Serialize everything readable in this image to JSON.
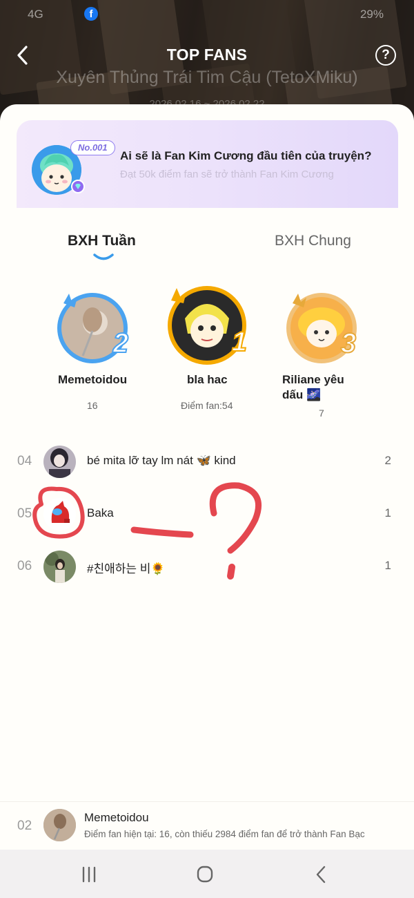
{
  "status_bar": {
    "left_text": "4G",
    "fb_glyph": "f",
    "right_text": "29%"
  },
  "header": {
    "title": "TOP FANS",
    "back_icon": "chevron-left-icon",
    "help_label": "?",
    "story_title": "Xuyên Thủng Trái Tim Cậu (TetoXMiku)",
    "date_range": "2026.02.16 ~ 2026.02.22"
  },
  "banner": {
    "tag": "No.001",
    "title": "Ai sẽ là Fan Kim Cương đầu tiên của truyện?",
    "subtitle": "Đạt 50k điểm fan sẽ trở thành Fan Kim Cương"
  },
  "tabs": [
    {
      "label": "BXH Tuần",
      "active": true
    },
    {
      "label": "BXH Chung",
      "active": false
    }
  ],
  "podium": {
    "first": {
      "name": "bla hac",
      "score": "Điểm fan:54",
      "rank": "1"
    },
    "second": {
      "name": "Memetoidou",
      "score": "16",
      "rank": "2"
    },
    "third": {
      "name_line1": "Riliane yêu",
      "name_line2": "dấu 🌌",
      "score": "7",
      "rank": "3"
    }
  },
  "ranking": [
    {
      "rank": "04",
      "name": "bé mita lỡ tay lm nát 🦋 kind",
      "score": "2"
    },
    {
      "rank": "05",
      "name": "Baka",
      "score": "1"
    },
    {
      "rank": "06",
      "name": "#친애하는 비🌻",
      "score": "1"
    }
  ],
  "my_rank": {
    "rank": "02",
    "name": "Memetoidou",
    "message": "Điểm fan hiện tại: 16, còn thiếu 2984 điểm fan để trở thành Fan Bạc"
  },
  "colors": {
    "accent": "#3a9bea",
    "gold": "#f5a900",
    "silver": "#4aa3f0",
    "bronze": "#f1c27a",
    "banner_bg": "#ece2fb",
    "annotation": "#e4474f"
  }
}
